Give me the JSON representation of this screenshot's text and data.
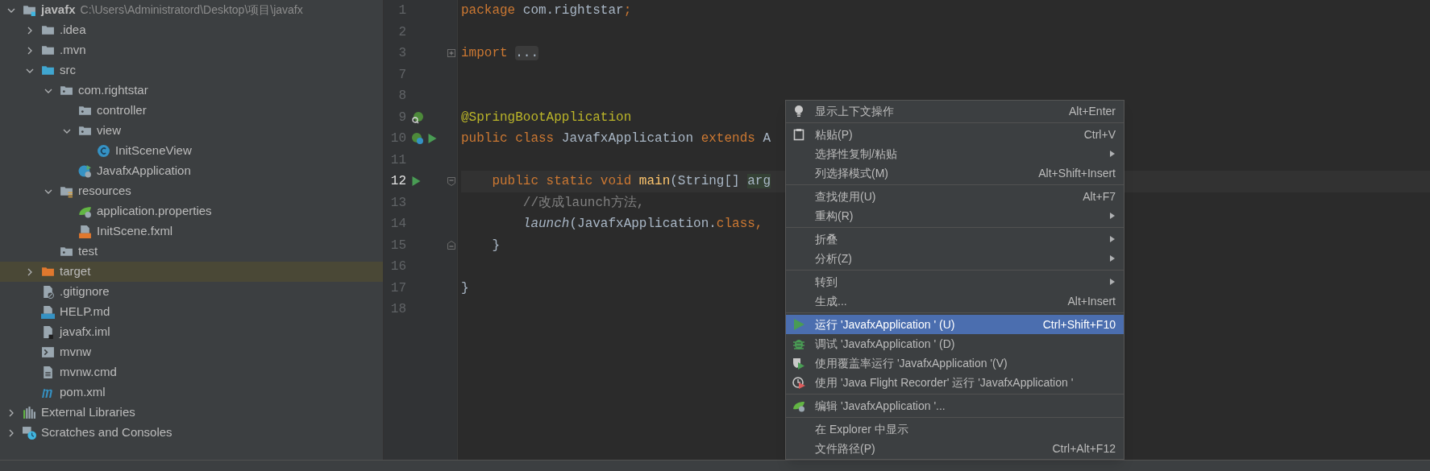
{
  "project_tree": {
    "items": [
      {
        "name": "javafx",
        "path": "C:\\Users\\Administratord\\Desktop\\项目\\javafx",
        "kind": "module",
        "expanded": true,
        "selected": false,
        "children": [
          {
            "name": ".idea",
            "kind": "folder",
            "expanded": false,
            "selected": false
          },
          {
            "name": ".mvn",
            "kind": "folder",
            "expanded": false,
            "selected": false
          },
          {
            "name": "src",
            "kind": "source-folder",
            "expanded": true,
            "selected": false,
            "children": [
              {
                "name": "com.rightstar",
                "kind": "package",
                "expanded": true,
                "selected": false,
                "children": [
                  {
                    "name": "controller",
                    "kind": "package",
                    "selected": false
                  },
                  {
                    "name": "view",
                    "kind": "package",
                    "expanded": true,
                    "selected": false,
                    "children": [
                      {
                        "name": "InitSceneView",
                        "kind": "class",
                        "selected": false
                      }
                    ]
                  },
                  {
                    "name": "JavafxApplication",
                    "kind": "spring-class",
                    "selected": false
                  }
                ]
              },
              {
                "name": "resources",
                "kind": "resources-folder",
                "expanded": true,
                "selected": false,
                "children": [
                  {
                    "name": "application.properties",
                    "kind": "spring-properties",
                    "selected": false
                  },
                  {
                    "name": "InitScene.fxml",
                    "kind": "fxml",
                    "selected": false
                  }
                ]
              },
              {
                "name": "test",
                "kind": "package",
                "selected": false
              }
            ]
          },
          {
            "name": "target",
            "kind": "excluded-folder",
            "expanded": false,
            "selected": true
          },
          {
            "name": ".gitignore",
            "kind": "ignore-file",
            "selected": false
          },
          {
            "name": "HELP.md",
            "kind": "markdown",
            "selected": false
          },
          {
            "name": "javafx.iml",
            "kind": "iml",
            "selected": false
          },
          {
            "name": "mvnw",
            "kind": "shell",
            "selected": false
          },
          {
            "name": "mvnw.cmd",
            "kind": "text-file",
            "selected": false
          },
          {
            "name": "pom.xml",
            "kind": "maven",
            "selected": false
          }
        ]
      },
      {
        "name": "External Libraries",
        "kind": "libraries",
        "expanded": false,
        "selected": false
      },
      {
        "name": "Scratches and Consoles",
        "kind": "scratches",
        "expanded": false,
        "selected": false
      }
    ]
  },
  "editor": {
    "lines": [
      {
        "number": "1",
        "current": false,
        "tokens": [
          {
            "kind": "keyword",
            "text": "package "
          },
          {
            "kind": "plain",
            "text": "com.rightstar"
          },
          {
            "kind": "keyword",
            "text": ";"
          }
        ]
      },
      {
        "number": "2",
        "current": false
      },
      {
        "number": "3",
        "current": false,
        "tokens": [
          {
            "kind": "keyword",
            "text": "import "
          },
          {
            "kind": "folded",
            "text": "..."
          }
        ]
      },
      {
        "number": "7",
        "current": false
      },
      {
        "number": "8",
        "current": false
      },
      {
        "number": "9",
        "current": false,
        "tokens": [
          {
            "kind": "annotation",
            "text": "@SpringBootApplication"
          }
        ]
      },
      {
        "number": "10",
        "current": false,
        "tokens": [
          {
            "kind": "keyword",
            "text": "public class "
          },
          {
            "kind": "plain",
            "text": "JavafxApplication "
          },
          {
            "kind": "keyword",
            "text": "extends "
          },
          {
            "kind": "plain",
            "text": "A"
          }
        ]
      },
      {
        "number": "11",
        "current": false
      },
      {
        "number": "12",
        "current": true,
        "tokens": [
          {
            "kind": "keyword",
            "text": "    public static void "
          },
          {
            "kind": "method",
            "text": "main"
          },
          {
            "kind": "plain",
            "text": "(String[] "
          },
          {
            "kind": "param-highlight",
            "text": "arg"
          }
        ]
      },
      {
        "number": "13",
        "current": false,
        "tokens": [
          {
            "kind": "comment",
            "text": "        //改成launch方法,"
          }
        ]
      },
      {
        "number": "14",
        "current": false,
        "tokens": [
          {
            "kind": "static-call",
            "text": "        launch"
          },
          {
            "kind": "plain",
            "text": "(JavafxApplication."
          },
          {
            "kind": "keyword",
            "text": "class, "
          }
        ]
      },
      {
        "number": "15",
        "current": false,
        "tokens": [
          {
            "kind": "plain",
            "text": "    }"
          }
        ]
      },
      {
        "number": "16",
        "current": false
      },
      {
        "number": "17",
        "current": false,
        "tokens": [
          {
            "kind": "plain",
            "text": "}"
          }
        ]
      },
      {
        "number": "18",
        "current": false
      }
    ]
  },
  "context_menu": {
    "items": [
      {
        "kind": "item",
        "label": "显示上下文操作",
        "shortcut": "Alt+Enter",
        "submenu": false,
        "selected": false
      },
      {
        "kind": "separator"
      },
      {
        "kind": "item",
        "label": "粘贴(P)",
        "shortcut": "Ctrl+V",
        "submenu": false,
        "selected": false
      },
      {
        "kind": "item",
        "label": "选择性复制/粘贴",
        "submenu": true,
        "selected": false
      },
      {
        "kind": "item",
        "label": "列选择模式(M)",
        "shortcut": "Alt+Shift+Insert",
        "submenu": false,
        "selected": false
      },
      {
        "kind": "separator"
      },
      {
        "kind": "item",
        "label": "查找使用(U)",
        "shortcut": "Alt+F7",
        "submenu": false,
        "selected": false
      },
      {
        "kind": "item",
        "label": "重构(R)",
        "submenu": true,
        "selected": false
      },
      {
        "kind": "separator"
      },
      {
        "kind": "item",
        "label": "折叠",
        "submenu": true,
        "selected": false
      },
      {
        "kind": "item",
        "label": "分析(Z)",
        "submenu": true,
        "selected": false
      },
      {
        "kind": "separator"
      },
      {
        "kind": "item",
        "label": "转到",
        "submenu": true,
        "selected": false
      },
      {
        "kind": "item",
        "label": "生成...",
        "shortcut": "Alt+Insert",
        "submenu": false,
        "selected": false
      },
      {
        "kind": "separator"
      },
      {
        "kind": "item",
        "label": "运行 'JavafxApplication ' (U)",
        "shortcut": "Ctrl+Shift+F10",
        "submenu": false,
        "selected": true
      },
      {
        "kind": "item",
        "label": "调试 'JavafxApplication ' (D)",
        "submenu": false,
        "selected": false
      },
      {
        "kind": "item",
        "label": "使用覆盖率运行  'JavafxApplication '(V)",
        "submenu": false,
        "selected": false
      },
      {
        "kind": "item",
        "label": "使用 'Java Flight Recorder' 运行 'JavafxApplication '",
        "submenu": false,
        "selected": false
      },
      {
        "kind": "separator"
      },
      {
        "kind": "item",
        "label": "编辑 'JavafxApplication '...",
        "submenu": false,
        "selected": false
      },
      {
        "kind": "separator"
      },
      {
        "kind": "item",
        "label": "在 Explorer 中显示",
        "submenu": false,
        "selected": false
      },
      {
        "kind": "item",
        "label": "文件路径(P)",
        "shortcut": "Ctrl+Alt+F12",
        "submenu": false,
        "selected": false
      }
    ]
  }
}
